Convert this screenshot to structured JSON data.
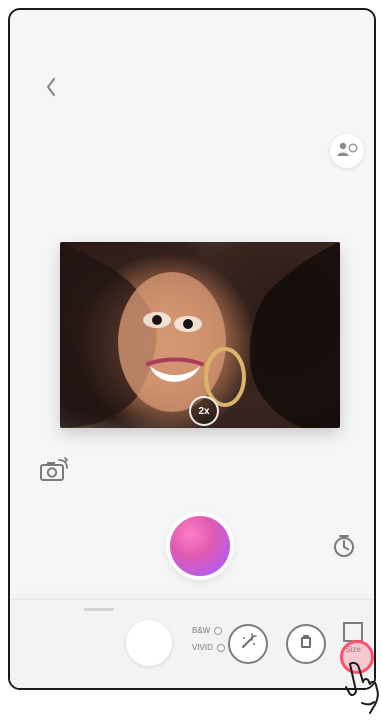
{
  "header": {
    "back_label": ""
  },
  "preview": {
    "zoom_label": "2x"
  },
  "filters": {
    "bw_label": "B&W",
    "vivid_label": "VIVID"
  },
  "size": {
    "label": "Size"
  },
  "colors": {
    "accent_pink": "#e05bb0",
    "accent_purple": "#8a4dd9",
    "tap_red": "#ff4f6c"
  },
  "icons": {
    "back": "chevron-left-icon",
    "face": "face-detect-icon",
    "camera_switch": "camera-switch-icon",
    "timer": "timer-icon",
    "magic": "magic-wand-icon",
    "sticker": "sticker-icon",
    "size": "square-size-icon"
  }
}
